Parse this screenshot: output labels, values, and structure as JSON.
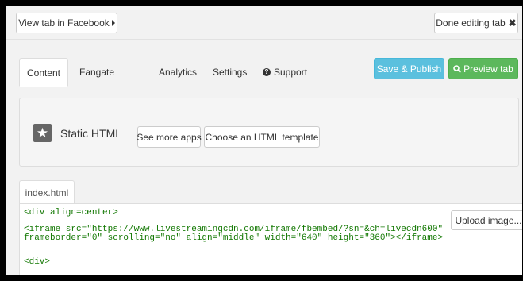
{
  "topbar": {
    "view_tab_label": "View tab in Facebook",
    "done_label": "Done editing tab"
  },
  "tabs": [
    {
      "label": "Content"
    },
    {
      "label": "Fangate"
    },
    {
      "label": "Analytics"
    },
    {
      "label": "Settings"
    },
    {
      "label": "Support"
    }
  ],
  "actions": {
    "publish_label": "Save & Publish",
    "preview_label": "Preview tab"
  },
  "app_panel": {
    "app_name": "Static HTML",
    "more_apps_label": "See more apps",
    "template_label": "Choose an HTML template"
  },
  "editor": {
    "file_tab": "index.html",
    "upload_label": "Upload image...",
    "lines": [
      "<div align=center>",
      "<iframe src=\"https://www.livestreamingcdn.com/iframe/fbembed/?sn=&ch=livecdn600\"",
      "frameborder=\"0\" scrolling=\"no\" align=\"middle\" width=\"640\" height=\"360\"></iframe>",
      "<div>"
    ]
  },
  "colors": {
    "publish": "#5bc0de",
    "preview": "#5cb85c"
  },
  "icons": {
    "caret": "caret-right-icon",
    "close": "close-icon",
    "support": "question-circle-icon",
    "preview": "search-icon",
    "app": "star-icon"
  }
}
